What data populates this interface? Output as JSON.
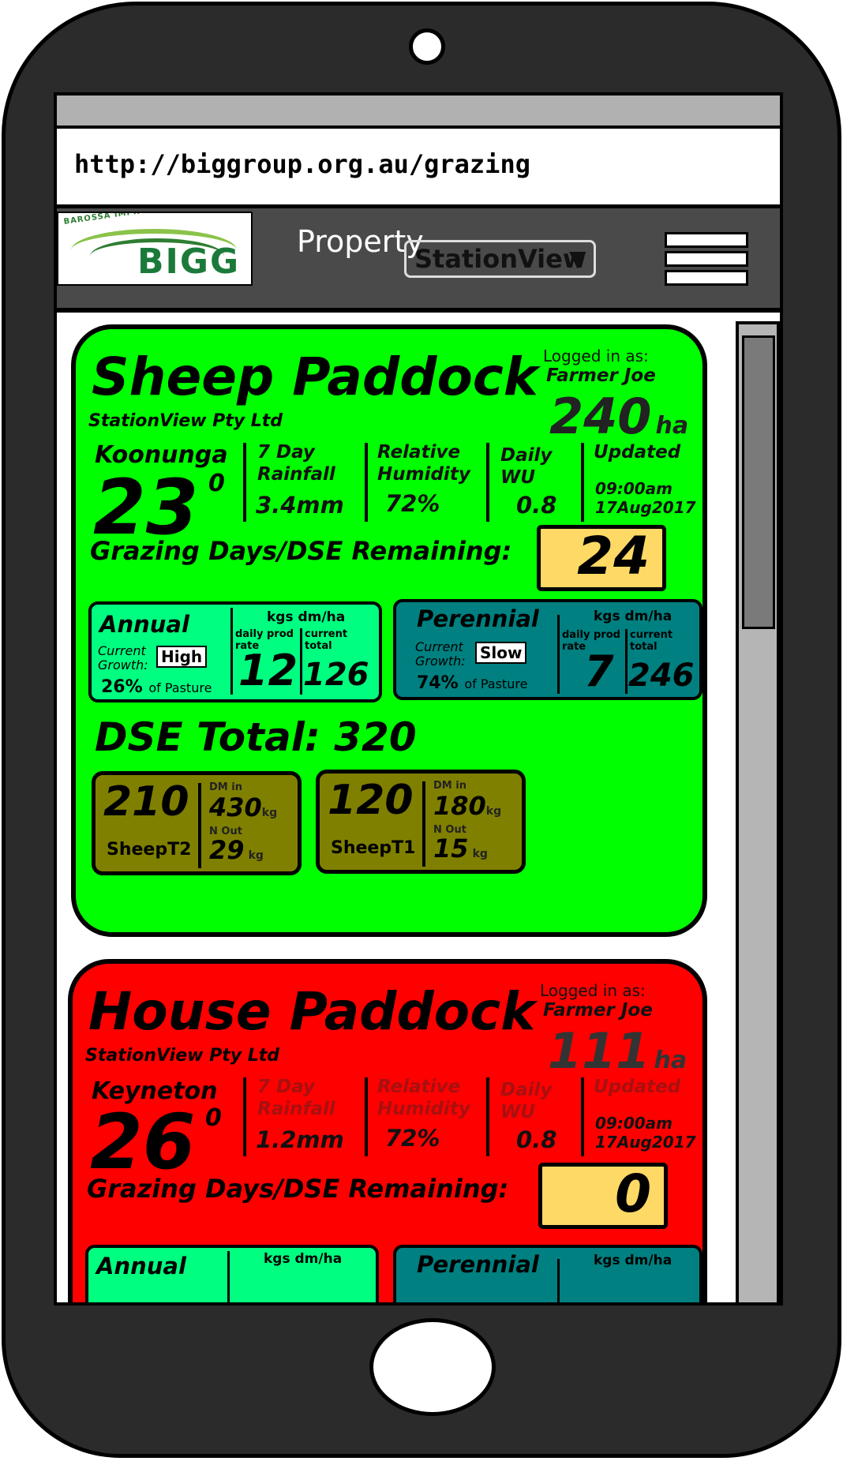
{
  "browser": {
    "url": "http://biggroup.org.au/grazing"
  },
  "app": {
    "logo_arc_text": "BAROSSA IMPROVED GRAZING GROUP",
    "logo_text": "BIGG",
    "property_label": "Property",
    "property_selected": "StationView",
    "caret": "▼"
  },
  "paddocks": [
    {
      "name": "Sheep Paddock",
      "company": "StationView Pty Ltd",
      "logged_in_label": "Logged in as:",
      "user": "Farmer Joe",
      "area": "240",
      "area_unit": "ha",
      "location": "Koonunga",
      "temperature": "23",
      "degree": "0",
      "rainfall_label_1": "7 Day",
      "rainfall_label_2": "Rainfall",
      "rainfall": "3.4mm",
      "humidity_label_1": "Relative",
      "humidity_label_2": "Humidity",
      "humidity": "72%",
      "wu_label_1": "Daily",
      "wu_label_2": "WU",
      "wu": "0.8",
      "updated_label": "Updated",
      "updated_time": "09:00am",
      "updated_date": "17Aug2017",
      "grazing_label": "Grazing Days/DSE Remaining:",
      "grazing_days": "24",
      "status_color": "#00ff00",
      "annual": {
        "name": "Annual",
        "growth_label_1": "Current",
        "growth_label_2": "Growth:",
        "growth": "High",
        "pct": "26%",
        "pct_suffix": "of Pasture",
        "units": "kgs dm/ha",
        "daily_label_1": "daily prod",
        "daily_label_2": "rate",
        "daily": "12",
        "total_label_1": "current",
        "total_label_2": "total",
        "total": "126"
      },
      "perennial": {
        "name": "Perennial",
        "growth_label_1": "Current",
        "growth_label_2": "Growth:",
        "growth": "Slow",
        "pct": "74%",
        "pct_suffix": "of Pasture",
        "units": "kgs dm/ha",
        "daily_label_1": "daily prod",
        "daily_label_2": "rate",
        "daily": "7",
        "total_label_1": "current",
        "total_label_2": "total",
        "total": "246"
      },
      "dse_total": "DSE Total: 320",
      "mobs": [
        {
          "dse": "210",
          "name": "SheepT2",
          "dm_label": "DM in",
          "dm": "430",
          "n_label": "N Out",
          "n": "29",
          "unit": "kg"
        },
        {
          "dse": "120",
          "name": "SheepT1",
          "dm_label": "DM in",
          "dm": "180",
          "n_label": "N Out",
          "n": "15",
          "unit": "kg"
        }
      ]
    },
    {
      "name": "House Paddock",
      "company": "StationView Pty Ltd",
      "logged_in_label": "Logged in as:",
      "user": "Farmer Joe",
      "area": "111",
      "area_unit": "ha",
      "location": "Keyneton",
      "temperature": "26",
      "degree": "0",
      "rainfall_label_1": "7 Day",
      "rainfall_label_2": "Rainfall",
      "rainfall": "1.2mm",
      "humidity_label_1": "Relative",
      "humidity_label_2": "Humidity",
      "humidity": "72%",
      "wu_label_1": "Daily",
      "wu_label_2": "WU",
      "wu": "0.8",
      "updated_label": "Updated",
      "updated_time": "09:00am",
      "updated_date": "17Aug2017",
      "grazing_label": "Grazing Days/DSE Remaining:",
      "grazing_days": "0",
      "status_color": "#ff0000",
      "annual": {
        "name": "Annual",
        "units": "kgs dm/ha"
      },
      "perennial": {
        "name": "Perennial",
        "units": "kgs dm/ha"
      }
    }
  ]
}
